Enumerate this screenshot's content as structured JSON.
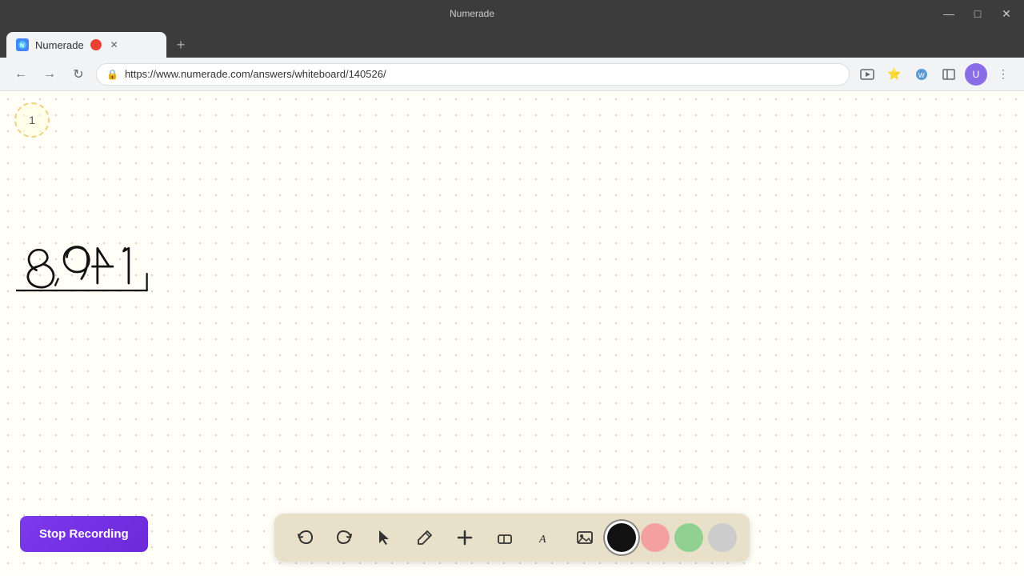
{
  "browser": {
    "title": "Numerade",
    "tab_label": "Numerade",
    "url": "https://www.numerade.com/answers/whiteboard/140526/",
    "favicon_text": "N"
  },
  "toolbar": {
    "undo_label": "↺",
    "redo_label": "↻",
    "select_label": "▶",
    "pen_label": "✏",
    "add_label": "+",
    "eraser_label": "◫",
    "text_label": "A",
    "image_label": "▣",
    "colors": [
      "#111111",
      "#f4a0a0",
      "#90d090",
      "#cccccc"
    ]
  },
  "stop_recording_btn": {
    "label": "Stop Recording"
  },
  "page_indicator": {
    "number": "1"
  },
  "whiteboard": {
    "background_color": "#fffff8"
  }
}
